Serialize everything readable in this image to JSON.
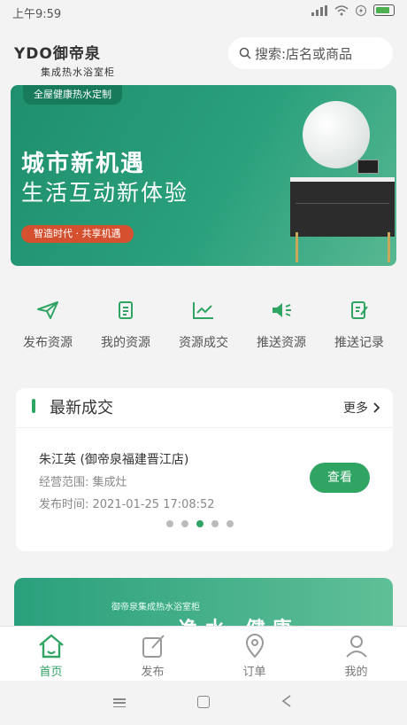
{
  "status_bar": {
    "time": "上午9:59",
    "battery_color": "#4caf50"
  },
  "header": {
    "logo_brand": "YDO御帝泉",
    "logo_sub": "集成热水浴室柜",
    "search_placeholder": "搜索:店名或商品"
  },
  "banner": {
    "tag": "全屋健康热水定制",
    "headline": "城市新机遇",
    "subheadline": "生活互动新体验",
    "pill": "智造时代 · 共享机遇"
  },
  "quick_actions": [
    {
      "label": "发布资源",
      "icon": "send-icon"
    },
    {
      "label": "我的资源",
      "icon": "document-icon"
    },
    {
      "label": "资源成交",
      "icon": "chart-icon"
    },
    {
      "label": "推送资源",
      "icon": "speaker-icon"
    },
    {
      "label": "推送记录",
      "icon": "edit-record-icon"
    }
  ],
  "latest_deals": {
    "title": "最新成交",
    "more_label": "更多",
    "item": {
      "name": "朱江英 (御帝泉福建晋江店)",
      "scope": "经营范围: 集成灶",
      "time": "发布时间: 2021-01-25 17:08:52",
      "button": "查看"
    },
    "carousel_active_index": 2,
    "carousel_count": 5
  },
  "promo_banner": {
    "text": "御帝泉集成热水浴室柜",
    "big": "净水 健康"
  },
  "tabbar": [
    {
      "label": "首页",
      "icon": "home-icon",
      "active": true
    },
    {
      "label": "发布",
      "icon": "publish-icon",
      "active": false
    },
    {
      "label": "订单",
      "icon": "order-location-icon",
      "active": false
    },
    {
      "label": "我的",
      "icon": "profile-icon",
      "active": false
    }
  ],
  "colors": {
    "accent": "#2fa463",
    "banner": "#2aa07c",
    "pill": "#d4502f"
  }
}
